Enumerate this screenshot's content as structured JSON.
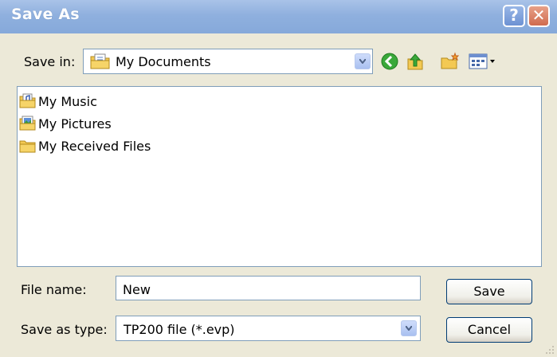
{
  "dialog": {
    "title": "Save As",
    "help_label": "?",
    "close_label": "✕"
  },
  "toolbar": {
    "save_in_label": "Save in:",
    "save_in_value": "My Documents",
    "icons": [
      "back-icon",
      "up-folder-icon",
      "new-folder-icon",
      "views-menu-icon"
    ]
  },
  "file_list": {
    "items": [
      {
        "label": "My Music",
        "icon": "music-folder-icon"
      },
      {
        "label": "My Pictures",
        "icon": "pictures-folder-icon"
      },
      {
        "label": "My Received Files",
        "icon": "folder-icon"
      }
    ]
  },
  "form": {
    "file_name_label": "File name:",
    "file_name_value": "New",
    "save_type_label": "Save as type:",
    "save_type_value": "TP200 file (*.evp)"
  },
  "buttons": {
    "save_label": "Save",
    "cancel_label": "Cancel"
  },
  "colors": {
    "titlebar": "#8fb0de",
    "dialog_bg": "#ece9d8",
    "border": "#7f9db9",
    "button_border": "#003c74"
  }
}
